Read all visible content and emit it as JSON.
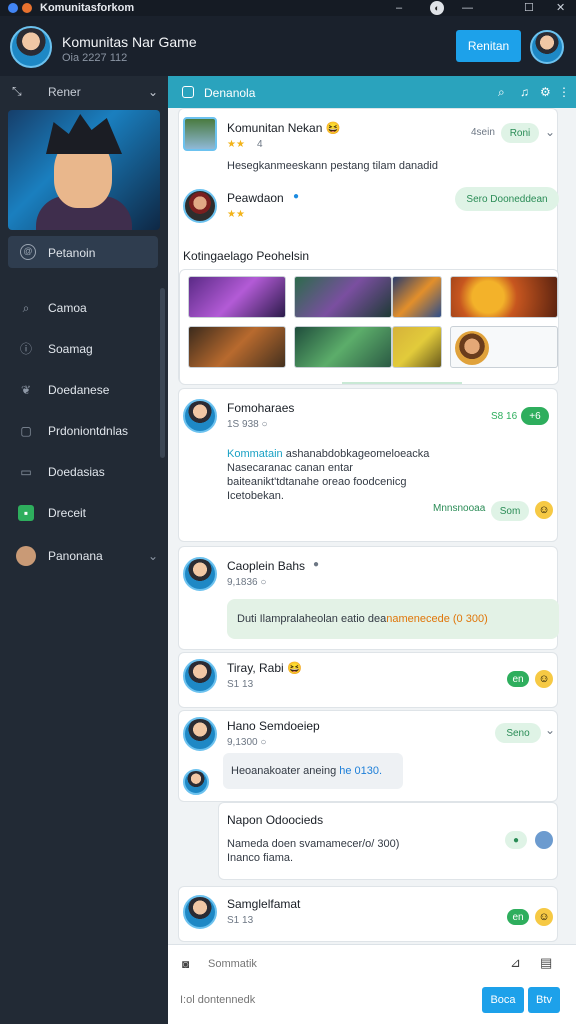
{
  "window": {
    "title": "Komunitasforkom"
  },
  "header": {
    "title": "Komunitas Nar Game",
    "subtitle": "Oia 2227 112",
    "button_label": "Renitan"
  },
  "sidebar": {
    "top_label": "Rener",
    "active_label": "Petanoin",
    "items": [
      {
        "label": "Camoa",
        "icon": "search-icon"
      },
      {
        "label": "Soamag",
        "icon": "info-icon"
      },
      {
        "label": "Doedanese",
        "icon": "bird-icon"
      },
      {
        "label": "Prdoniontdnlas",
        "icon": "window-icon"
      },
      {
        "label": "Doedasias",
        "icon": "chat-icon"
      },
      {
        "label": "Dreceit",
        "icon": "app-icon"
      },
      {
        "label": "Panonana",
        "icon": "avatar-icon"
      }
    ]
  },
  "main": {
    "header_label": "Denanola",
    "post1": {
      "name": "Komunitan Nekan",
      "emoji": "😆",
      "meta": "4",
      "time": "4sein",
      "pill": "Roni",
      "text": "Hesegkanmeeskann pestang tilam danadid"
    },
    "post2": {
      "name": "Peawdaon",
      "pill": "Sero Dooneddean"
    },
    "gallery_title": "Kotingaelago Peohelsin",
    "post3": {
      "name": "Fomoharaes",
      "sub": "1S 938 ○",
      "badge_num": "S8 16",
      "badge": "+6",
      "highlight": "Kommatain",
      "text": " ashanabdobkageomeloeacka Nasecaranac canan entar baiteanikt'tdtanahe oreao foodcenicg Icetobekan.",
      "action_label": "Mnnsnooaa",
      "pill": "Som"
    },
    "post4": {
      "name": "Caoplein Bahs",
      "sub": "9,1836 ○",
      "bubble_text": "Duti Ilampralaheolan eatio dea",
      "bubble_accent": "namenecede (0 300)"
    },
    "post5": {
      "name": "Tiray, Rabi",
      "emoji": "😆",
      "sub": "S1 13",
      "pill": "en"
    },
    "post6": {
      "name": "Hano Semdoeiep",
      "sub": "9,1300 ○",
      "pill": "Seno",
      "bubble_text": "Heoanakoater aneing",
      "bubble_accent": "he 0130."
    },
    "post7": {
      "name": "Napon Odoocieds",
      "text": "Nameda doen svamamecer/o/ 300) Inanco fiama."
    },
    "post8": {
      "name": "Samglelfamat",
      "sub": "S1 13",
      "pill": "en"
    },
    "composer": {
      "placeholder": "Sommatik",
      "bottom_placeholder": "I:ol dontennedk",
      "send_label": "Boca",
      "btn2_label": "Btv"
    }
  }
}
